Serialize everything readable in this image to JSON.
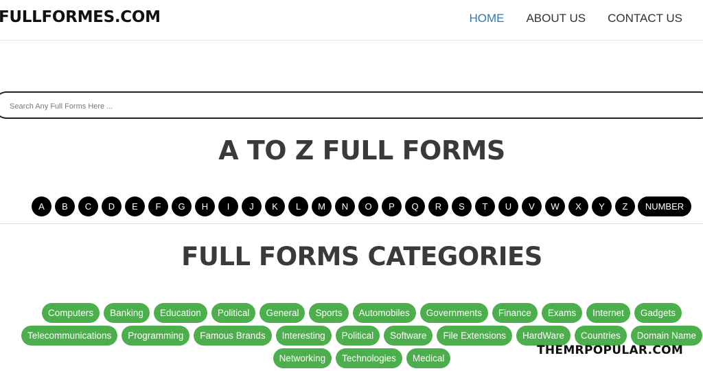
{
  "header": {
    "logo": "FULLFORMES.COM",
    "nav": [
      "HOME",
      "ABOUT US",
      "CONTACT US"
    ],
    "active_nav": "HOME"
  },
  "search": {
    "placeholder": "Search Any Full Forms Here ..."
  },
  "az_section": {
    "title": "A TO Z FULL FORMS",
    "letters": [
      "A",
      "B",
      "C",
      "D",
      "E",
      "F",
      "G",
      "H",
      "I",
      "J",
      "K",
      "L",
      "M",
      "N",
      "O",
      "P",
      "Q",
      "R",
      "S",
      "T",
      "U",
      "V",
      "W",
      "X",
      "Y",
      "Z"
    ],
    "number_label": "NUMBER"
  },
  "categories_section": {
    "title": "FULL FORMS CATEGORIES",
    "rows": [
      [
        "Computers",
        "Banking",
        "Education",
        "Political",
        "General",
        "Sports",
        "Automobiles",
        "Governments",
        "Finance",
        "Exams",
        "Internet",
        "Gadgets"
      ],
      [
        "Telecommunications",
        "Programming",
        "Famous Brands",
        "Interesting",
        "Political",
        "Software",
        "File Extensions",
        "HardWare",
        "Countries",
        "Domain Name"
      ],
      [
        "Networking",
        "Technologies",
        "Medical"
      ]
    ]
  },
  "watermark": "THEMRPOPULAR.COM",
  "colors": {
    "active_nav": "#2a7ab8",
    "chip_green": "#4cae4c",
    "letter_black": "#000000"
  }
}
